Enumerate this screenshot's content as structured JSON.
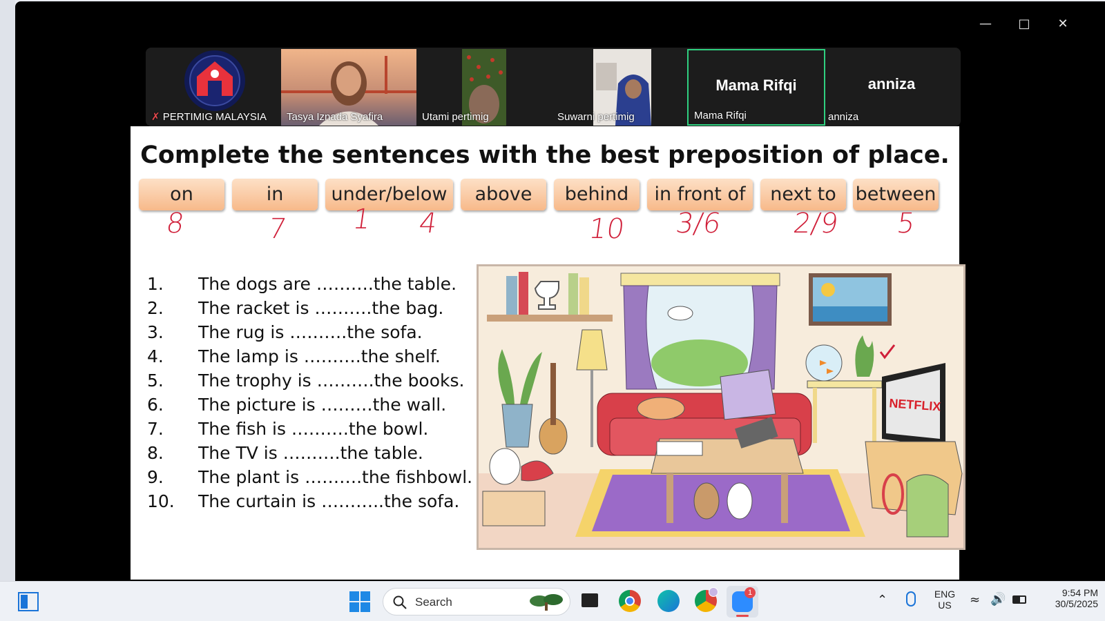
{
  "participants": [
    {
      "name": "PERTIMIG MALAYSIA",
      "muted": true
    },
    {
      "name": "Tasya Iznada Syafira"
    },
    {
      "name": "Utami pertimig"
    },
    {
      "name": "Suwarni pertimig"
    },
    {
      "name": "Mama Rifqi",
      "big_name": "Mama Rifqi",
      "active": true
    },
    {
      "name": "anniza",
      "big_name": "anniza"
    }
  ],
  "slide": {
    "title": "Complete the sentences with the best preposition of place.",
    "prepositions": [
      "on",
      "in",
      "under/below",
      "above",
      "behind",
      "in front of",
      "next to",
      "between"
    ],
    "handwritten": [
      "8",
      "7",
      "1",
      "4",
      "10",
      "3/6",
      "2/9",
      "5"
    ],
    "sentences": [
      {
        "num": "1.",
        "text": "The dogs are ……….the table."
      },
      {
        "num": "2.",
        "text": "The racket is ……….the bag."
      },
      {
        "num": "3.",
        "text": "The rug is ……….the sofa."
      },
      {
        "num": "4.",
        "text": "The lamp is ……….the shelf."
      },
      {
        "num": "5.",
        "text": "The trophy is ……….the books."
      },
      {
        "num": "6.",
        "text": "The picture is ………the wall."
      },
      {
        "num": "7.",
        "text": "The fish is ……….the bowl."
      },
      {
        "num": "8.",
        "text": "The TV is ……….the table."
      },
      {
        "num": "9.",
        "text": "The plant is ……….the fishbowl."
      },
      {
        "num": "10.",
        "text": "The curtain is ………..the sofa."
      }
    ],
    "scene_tv_brand": "NETFLIX"
  },
  "taskbar": {
    "search_placeholder": "Search",
    "language": "ENG",
    "region": "US",
    "time": "9:54 PM",
    "date": "30/5/2025",
    "zoom_badge": "1"
  },
  "colors": {
    "accent_active": "#2fd080",
    "chip": "#f7b98a",
    "ink": "#d0203a"
  }
}
